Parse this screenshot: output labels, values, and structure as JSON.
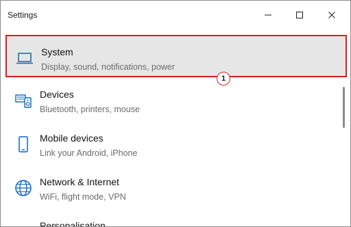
{
  "window": {
    "title": "Settings"
  },
  "titlebar_buttons": {
    "minimize_icon": "minimize-icon",
    "maximize_icon": "maximize-icon",
    "close_icon": "close-icon"
  },
  "settings": {
    "items": [
      {
        "label": "System",
        "description": "Display, sound, notifications, power",
        "icon": "laptop-icon",
        "selected": true
      },
      {
        "label": "Devices",
        "description": "Bluetooth, printers, mouse",
        "icon": "devices-icon"
      },
      {
        "label": "Mobile devices",
        "description": "Link your Android, iPhone",
        "icon": "phone-icon"
      },
      {
        "label": "Network & Internet",
        "description": "WiFi, flight mode, VPN",
        "icon": "globe-icon"
      }
    ],
    "partial_item_label": "Personalisation"
  },
  "annotation": {
    "step_number": "1"
  },
  "colors": {
    "accent_blue": "#0a64c8",
    "highlight_red": "#e21b1b",
    "selected_bg": "#e6e6e6"
  }
}
